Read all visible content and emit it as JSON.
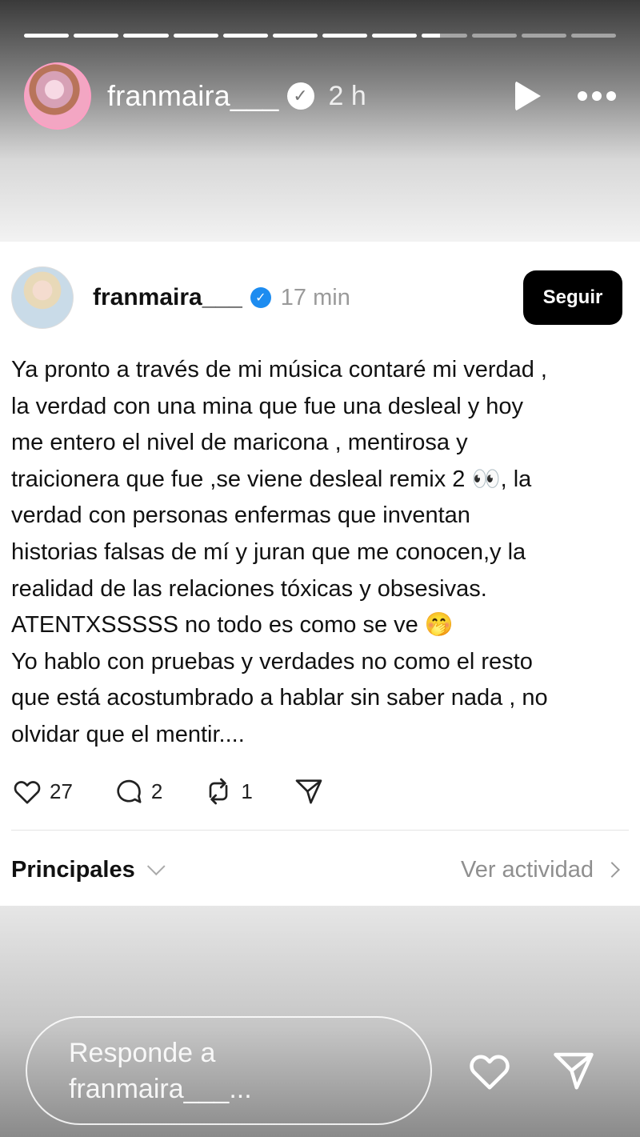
{
  "story": {
    "progress_segments": [
      1,
      1,
      1,
      1,
      1,
      1,
      1,
      1,
      0.4,
      0,
      0,
      0
    ],
    "username": "franmaira___",
    "time": "2 h"
  },
  "post": {
    "username": "franmaira___",
    "time": "17 min",
    "follow_label": "Seguir",
    "lines": [
      "Ya pronto a través de mi música contaré mi verdad ,",
      "la verdad con una mina que fue una desleal y hoy",
      "me entero el nivel de maricona , mentirosa y",
      "traicionera que fue ,se viene desleal remix 2 👀, la",
      "verdad con personas enfermas que inventan",
      "historias falsas de mí y juran que me conocen,y la",
      "realidad de las relaciones tóxicas y obsesivas.",
      "ATENTXSSSSS no todo es como se ve 🤭",
      "Yo hablo con pruebas y verdades no como el resto",
      "que está acostumbrado a hablar sin saber nada , no",
      "olvidar que el mentir...."
    ],
    "likes": "27",
    "comments": "2",
    "reposts": "1",
    "sort_label": "Principales",
    "activity_label": "Ver actividad"
  },
  "reply": {
    "placeholder": "Responde a\nfranmaira___..."
  },
  "colors": {
    "verified_blue": "#1d8cf0",
    "follow_button": "#000000"
  }
}
